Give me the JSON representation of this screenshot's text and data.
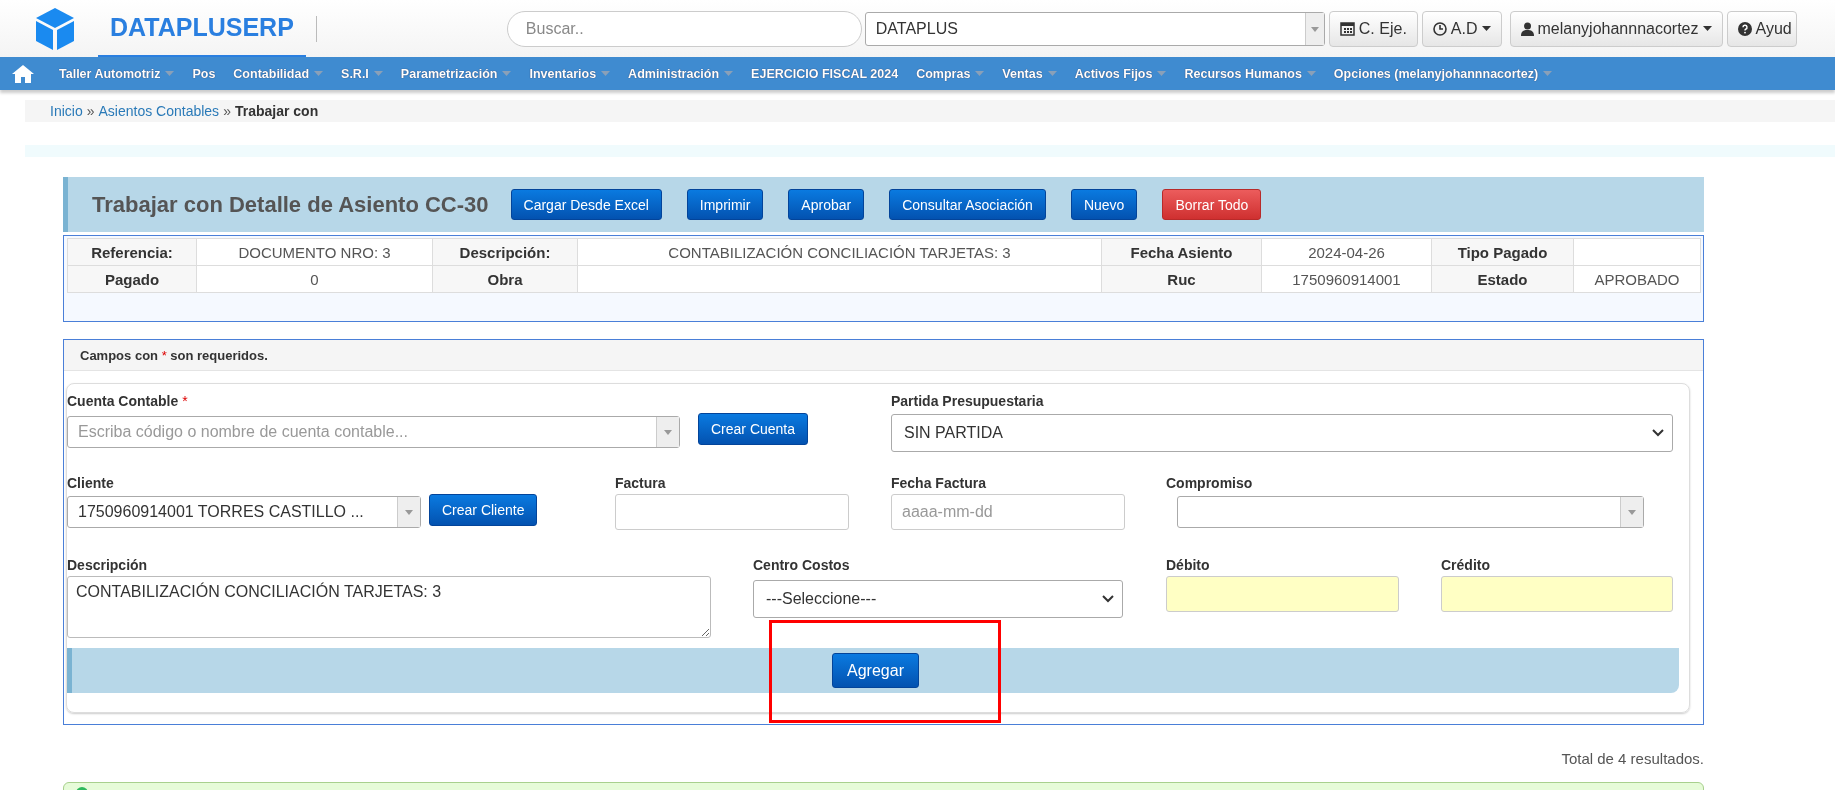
{
  "header": {
    "brand": "DATAPLUSERP",
    "search": {
      "placeholder": "Buscar.."
    },
    "company_select": {
      "value": "DATAPLUS"
    },
    "buttons": [
      {
        "kind": "calendar",
        "label": "C. Eje.",
        "dropdown": false
      },
      {
        "kind": "clock",
        "label": "A.D",
        "dropdown": true
      },
      {
        "kind": "user",
        "label": "melanyjohannnacortez",
        "dropdown": true
      },
      {
        "kind": "help",
        "label": "Ayud",
        "dropdown": false
      }
    ]
  },
  "nav": {
    "items": [
      {
        "label": "Taller Automotriz",
        "has_menu": true
      },
      {
        "label": "Pos",
        "has_menu": false
      },
      {
        "label": "Contabilidad",
        "has_menu": true
      },
      {
        "label": "S.R.I",
        "has_menu": true
      },
      {
        "label": "Parametrización",
        "has_menu": true
      },
      {
        "label": "Inventarios",
        "has_menu": true
      },
      {
        "label": "Administración",
        "has_menu": true
      },
      {
        "label": "EJERCICIO FISCAL 2024",
        "has_menu": false
      },
      {
        "label": "Compras",
        "has_menu": true
      },
      {
        "label": "Ventas",
        "has_menu": true
      },
      {
        "label": "Activos Fijos",
        "has_menu": true
      },
      {
        "label": "Recursos Humanos",
        "has_menu": true
      },
      {
        "label": "Opciones (melanyjohannnacortez)",
        "has_menu": true
      }
    ]
  },
  "breadcrumb": {
    "separator": "»",
    "items": [
      {
        "label": "Inicio",
        "kind": "link"
      },
      {
        "label": "Asientos Contables",
        "kind": "link"
      },
      {
        "label": "Trabajar con",
        "kind": "current"
      }
    ]
  },
  "panel": {
    "title": "Trabajar con Detalle de Asiento CC-30",
    "buttons": [
      {
        "label": "Cargar Desde Excel",
        "kind": "primary"
      },
      {
        "label": "Imprimir",
        "kind": "primary"
      },
      {
        "label": "Aprobar",
        "kind": "primary"
      },
      {
        "label": "Consultar Asociación",
        "kind": "primary"
      },
      {
        "label": "Nuevo",
        "kind": "primary"
      },
      {
        "label": "Borrar Todo",
        "kind": "danger"
      }
    ]
  },
  "info_table": {
    "rows": [
      [
        {
          "text": "Referencia:",
          "kind": "label"
        },
        {
          "text": "DOCUMENTO NRO: 3",
          "kind": "value"
        },
        {
          "text": "Descripción:",
          "kind": "label"
        },
        {
          "text": "CONTABILIZACIÓN CONCILIACIÓN TARJETAS: 3",
          "kind": "value"
        },
        {
          "text": "Fecha Asiento",
          "kind": "label"
        },
        {
          "text": "2024-04-26",
          "kind": "value"
        },
        {
          "text": "Tipo Pagado",
          "kind": "label"
        },
        {
          "text": "",
          "kind": "value"
        }
      ],
      [
        {
          "text": "Pagado",
          "kind": "label"
        },
        {
          "text": "0",
          "kind": "value"
        },
        {
          "text": "Obra",
          "kind": "label"
        },
        {
          "text": "",
          "kind": "value"
        },
        {
          "text": "Ruc",
          "kind": "label"
        },
        {
          "text": "1750960914001",
          "kind": "value"
        },
        {
          "text": "Estado",
          "kind": "label"
        },
        {
          "text": "APROBADO",
          "kind": "value"
        }
      ]
    ]
  },
  "form": {
    "note": {
      "before": "Campos con",
      "mark": "*",
      "after": "son requeridos."
    },
    "fields": [
      {
        "kind": "combo",
        "label": "Cuenta Contable",
        "required": true,
        "placeholder": "Escriba código o nombre de cuenta contable...",
        "button": "Crear Cuenta"
      },
      {
        "kind": "select",
        "label": "Partida Presupuestaria",
        "required": false,
        "value": "SIN PARTIDA"
      },
      {
        "kind": "combo",
        "label": "Cliente",
        "required": false,
        "value": "1750960914001 TORRES CASTILLO ...",
        "button": "Crear Cliente"
      },
      {
        "kind": "input",
        "label": "Factura",
        "required": false
      },
      {
        "kind": "input",
        "label": "Fecha Factura",
        "required": false,
        "placeholder": "aaaa-mm-dd"
      },
      {
        "kind": "combo",
        "label": "Compromiso",
        "required": false
      },
      {
        "kind": "textarea",
        "label": "Descripción",
        "required": false,
        "value": "CONTABILIZACIÓN CONCILIACIÓN TARJETAS: 3"
      },
      {
        "kind": "select",
        "label": "Centro Costos",
        "required": false,
        "value": "---Seleccione---"
      },
      {
        "kind": "amount",
        "label": "Débito",
        "required": false
      },
      {
        "kind": "amount",
        "label": "Crédito",
        "required": false
      }
    ],
    "submit": "Agregar"
  },
  "results": "Total de 4 resultados."
}
